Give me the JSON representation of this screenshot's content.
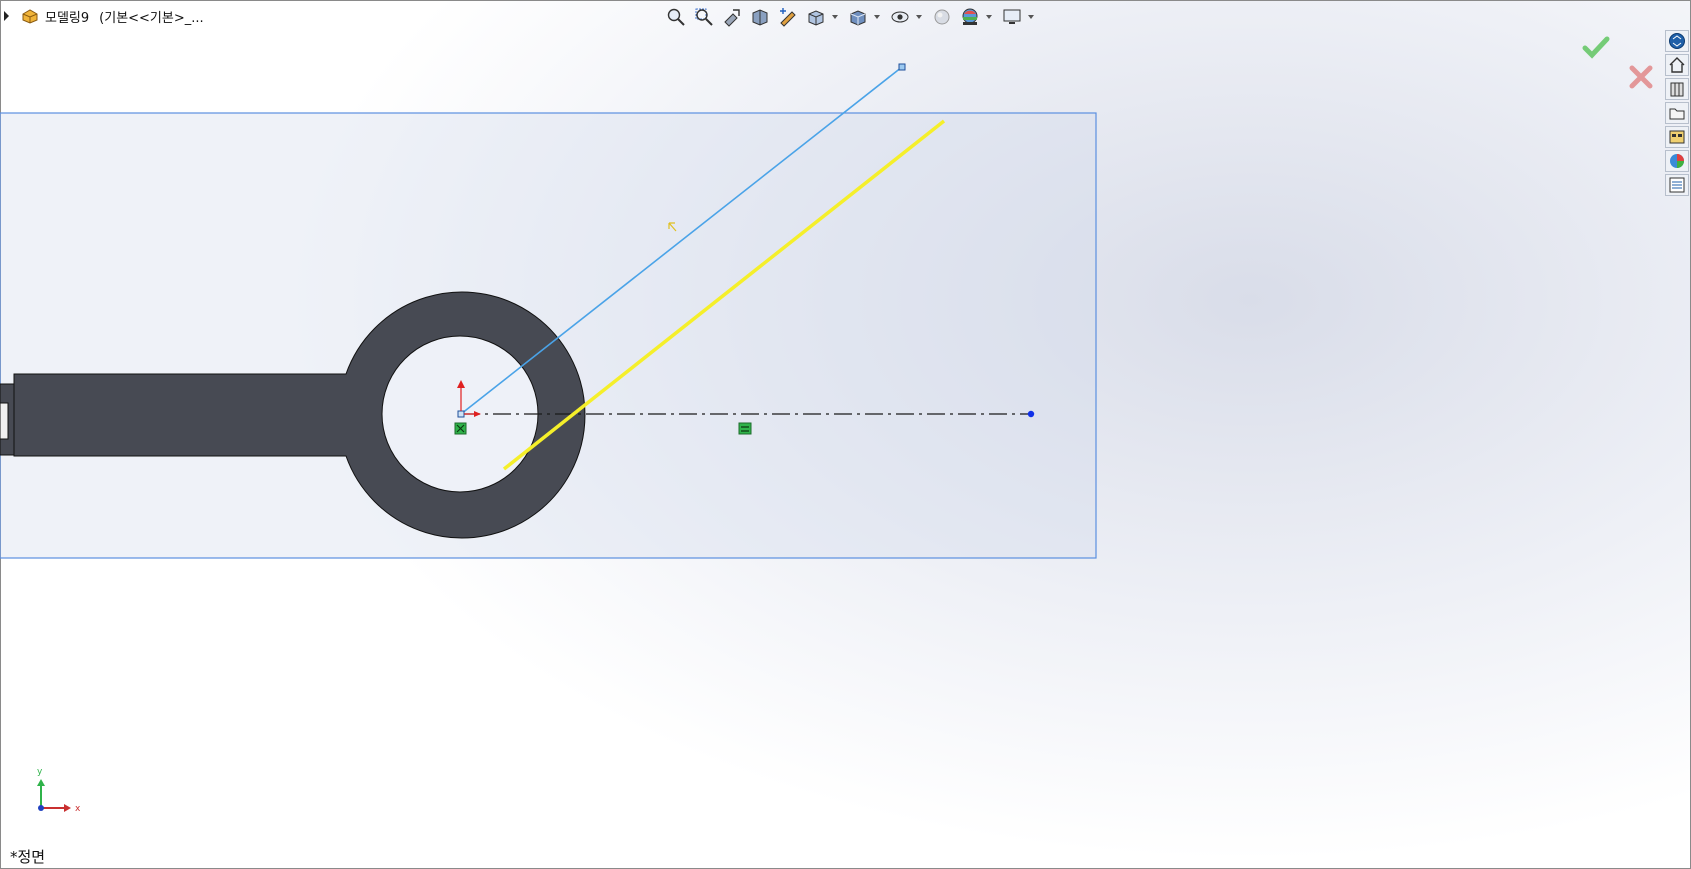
{
  "document": {
    "name": "모델링9",
    "config": "(기본<<기본>_..."
  },
  "hud_toolbar": [
    {
      "name": "zoom-to-fit-icon"
    },
    {
      "name": "zoom-to-area-icon"
    },
    {
      "name": "previous-view-icon"
    },
    {
      "name": "section-view-icon"
    },
    {
      "name": "dynamic-annotation-icon"
    },
    {
      "name": "view-orientation-icon",
      "dropdown": true
    },
    {
      "name": "display-style-icon",
      "dropdown": true
    },
    {
      "name": "hide-show-items-icon",
      "dropdown": true
    },
    {
      "name": "edit-appearance-icon"
    },
    {
      "name": "apply-scene-icon",
      "dropdown": true
    },
    {
      "name": "view-settings-icon",
      "dropdown": true
    }
  ],
  "task_pane": [
    {
      "name": "solidworks-resources-icon"
    },
    {
      "name": "home-icon"
    },
    {
      "name": "design-library-icon"
    },
    {
      "name": "file-explorer-icon"
    },
    {
      "name": "view-palette-icon"
    },
    {
      "name": "appearances-icon"
    },
    {
      "name": "custom-properties-icon"
    }
  ],
  "triad": {
    "x_label": "x",
    "y_label": "y"
  },
  "view_name": "*정면",
  "colors": {
    "part_fill": "#474a53",
    "sketch_line": "#4aa3e8",
    "highlight_line": "#f5ef2a",
    "centerline": "#1a1a1a",
    "plane_border": "#5b8fe0",
    "relation_badge": "#2fb34a",
    "accept": "#4cbf4c",
    "reject": "#e07a7a"
  }
}
